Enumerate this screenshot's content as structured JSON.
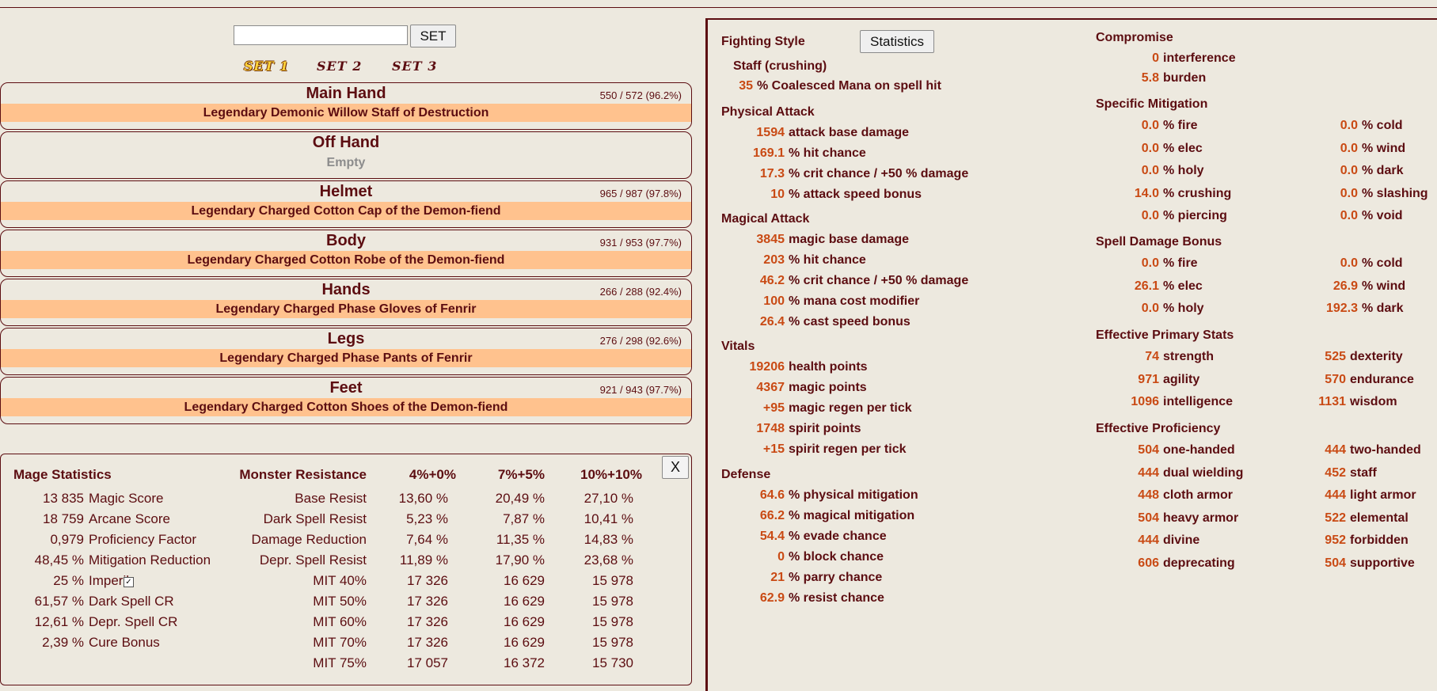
{
  "search": {
    "value": "",
    "set_label": "SET"
  },
  "set_tabs": [
    {
      "label": "SET 1",
      "active": true
    },
    {
      "label": "SET 2",
      "active": false
    },
    {
      "label": "SET 3",
      "active": false
    }
  ],
  "slots": [
    {
      "title": "Main Hand",
      "durability": "550 / 572 (96.2%)",
      "item": "Legendary Demonic Willow Staff of Destruction"
    },
    {
      "title": "Off Hand",
      "durability": "",
      "item": "",
      "empty": "Empty"
    },
    {
      "title": "Helmet",
      "durability": "965 / 987 (97.8%)",
      "item": "Legendary Charged Cotton Cap of the Demon-fiend"
    },
    {
      "title": "Body",
      "durability": "931 / 953 (97.7%)",
      "item": "Legendary Charged Cotton Robe of the Demon-fiend"
    },
    {
      "title": "Hands",
      "durability": "266 / 288 (92.4%)",
      "item": "Legendary Charged Phase Gloves of Fenrir"
    },
    {
      "title": "Legs",
      "durability": "276 / 298 (92.6%)",
      "item": "Legendary Charged Phase Pants of Fenrir"
    },
    {
      "title": "Feet",
      "durability": "921 / 943 (97.7%)",
      "item": "Legendary Charged Cotton Shoes of the Demon-fiend"
    }
  ],
  "mage_stats": {
    "title": "Mage Statistics",
    "rows": [
      {
        "value": "13 835",
        "label": "Magic Score"
      },
      {
        "value": "18 759",
        "label": "Arcane Score"
      },
      {
        "value": "0,979",
        "label": "Proficiency Factor"
      },
      {
        "value": "48,45 %",
        "label": "Mitigation Reduction"
      },
      {
        "value": "25 %",
        "label": "Imperil",
        "checkbox": "✓"
      },
      {
        "value": "61,57 %",
        "label": "Dark Spell CR"
      },
      {
        "value": "12,61 %",
        "label": "Depr. Spell CR"
      },
      {
        "value": "2,39 %",
        "label": "Cure Bonus"
      }
    ]
  },
  "monster_resistance": {
    "title": "Monster Resistance",
    "columns": [
      "4%+0%",
      "7%+5%",
      "10%+10%"
    ],
    "rows": [
      {
        "label": "Base Resist",
        "values": [
          "13,60 %",
          "20,49 %",
          "27,10 %"
        ]
      },
      {
        "label": "Dark Spell Resist",
        "values": [
          "5,23 %",
          "7,87 %",
          "10,41 %"
        ]
      },
      {
        "label": "Damage Reduction",
        "values": [
          "7,64 %",
          "11,35 %",
          "14,83 %"
        ]
      },
      {
        "label": "Depr. Spell Resist",
        "values": [
          "11,89 %",
          "17,90 %",
          "23,68 %"
        ]
      },
      {
        "label": "MIT 40%",
        "values": [
          "17 326",
          "16 629",
          "15 978"
        ]
      },
      {
        "label": "MIT 50%",
        "values": [
          "17 326",
          "16 629",
          "15 978"
        ]
      },
      {
        "label": "MIT 60%",
        "values": [
          "17 326",
          "16 629",
          "15 978"
        ]
      },
      {
        "label": "MIT 70%",
        "values": [
          "17 326",
          "16 629",
          "15 978"
        ]
      },
      {
        "label": "MIT 75%",
        "values": [
          "17 057",
          "16 372",
          "15 730"
        ]
      }
    ],
    "close_label": "X"
  },
  "right": {
    "fighting_style_label": "Fighting Style",
    "statistics_label": "Statistics",
    "fighting_style": "Staff (crushing)",
    "fighting_style_bonus": {
      "value": "35",
      "label": "% Coalesced Mana on spell hit"
    },
    "physical_attack": {
      "title": "Physical Attack",
      "rows": [
        {
          "value": "1594",
          "label": "attack base damage"
        },
        {
          "value": "169.1",
          "label": "% hit chance"
        },
        {
          "value": "17.3",
          "label": "% crit chance / +50 % damage"
        },
        {
          "value": "10",
          "label": "% attack speed bonus"
        }
      ]
    },
    "magical_attack": {
      "title": "Magical Attack",
      "rows": [
        {
          "value": "3845",
          "label": "magic base damage"
        },
        {
          "value": "203",
          "label": "% hit chance"
        },
        {
          "value": "46.2",
          "label": "% crit chance / +50 % damage"
        },
        {
          "value": "100",
          "label": "% mana cost modifier"
        },
        {
          "value": "26.4",
          "label": "% cast speed bonus"
        }
      ]
    },
    "vitals": {
      "title": "Vitals",
      "rows": [
        {
          "value": "19206",
          "label": "health points"
        },
        {
          "value": "4367",
          "label": "magic points"
        },
        {
          "value": "+95",
          "label": "magic regen per tick"
        },
        {
          "value": "1748",
          "label": "spirit points"
        },
        {
          "value": "+15",
          "label": "spirit regen per tick"
        }
      ]
    },
    "defense": {
      "title": "Defense",
      "rows": [
        {
          "value": "64.6",
          "label": "% physical mitigation"
        },
        {
          "value": "66.2",
          "label": "% magical mitigation"
        },
        {
          "value": "54.4",
          "label": "% evade chance"
        },
        {
          "value": "0",
          "label": "% block chance"
        },
        {
          "value": "21",
          "label": "% parry chance"
        },
        {
          "value": "62.9",
          "label": "% resist chance"
        }
      ]
    },
    "compromise": {
      "title": "Compromise",
      "rows": [
        {
          "value": "0",
          "label": "interference"
        },
        {
          "value": "5.8",
          "label": "burden"
        }
      ]
    },
    "specific_mitigation": {
      "title": "Specific Mitigation",
      "rows": [
        [
          {
            "value": "0.0",
            "label": "% fire"
          },
          {
            "value": "0.0",
            "label": "% cold"
          }
        ],
        [
          {
            "value": "0.0",
            "label": "% elec"
          },
          {
            "value": "0.0",
            "label": "% wind"
          }
        ],
        [
          {
            "value": "0.0",
            "label": "% holy"
          },
          {
            "value": "0.0",
            "label": "% dark"
          }
        ],
        [
          {
            "value": "14.0",
            "label": "% crushing"
          },
          {
            "value": "0.0",
            "label": "% slashing"
          }
        ],
        [
          {
            "value": "0.0",
            "label": "% piercing"
          },
          {
            "value": "0.0",
            "label": "% void"
          }
        ]
      ]
    },
    "spell_damage_bonus": {
      "title": "Spell Damage Bonus",
      "rows": [
        [
          {
            "value": "0.0",
            "label": "% fire"
          },
          {
            "value": "0.0",
            "label": "% cold"
          }
        ],
        [
          {
            "value": "26.1",
            "label": "% elec"
          },
          {
            "value": "26.9",
            "label": "% wind"
          }
        ],
        [
          {
            "value": "0.0",
            "label": "% holy"
          },
          {
            "value": "192.3",
            "label": "% dark"
          }
        ]
      ]
    },
    "primary_stats": {
      "title": "Effective Primary Stats",
      "rows": [
        [
          {
            "value": "74",
            "label": "strength"
          },
          {
            "value": "525",
            "label": "dexterity"
          }
        ],
        [
          {
            "value": "971",
            "label": "agility"
          },
          {
            "value": "570",
            "label": "endurance"
          }
        ],
        [
          {
            "value": "1096",
            "label": "intelligence"
          },
          {
            "value": "1131",
            "label": "wisdom"
          }
        ]
      ]
    },
    "proficiency": {
      "title": "Effective Proficiency",
      "rows": [
        [
          {
            "value": "504",
            "label": "one-handed"
          },
          {
            "value": "444",
            "label": "two-handed"
          }
        ],
        [
          {
            "value": "444",
            "label": "dual wielding"
          },
          {
            "value": "452",
            "label": "staff"
          }
        ],
        [
          {
            "value": "448",
            "label": "cloth armor"
          },
          {
            "value": "444",
            "label": "light armor"
          }
        ],
        [
          {
            "value": "504",
            "label": "heavy armor"
          },
          {
            "value": "522",
            "label": "elemental"
          }
        ],
        [
          {
            "value": "444",
            "label": "divine"
          },
          {
            "value": "952",
            "label": "forbidden"
          }
        ],
        [
          {
            "value": "606",
            "label": "deprecating"
          },
          {
            "value": "504",
            "label": "supportive"
          }
        ]
      ]
    }
  }
}
